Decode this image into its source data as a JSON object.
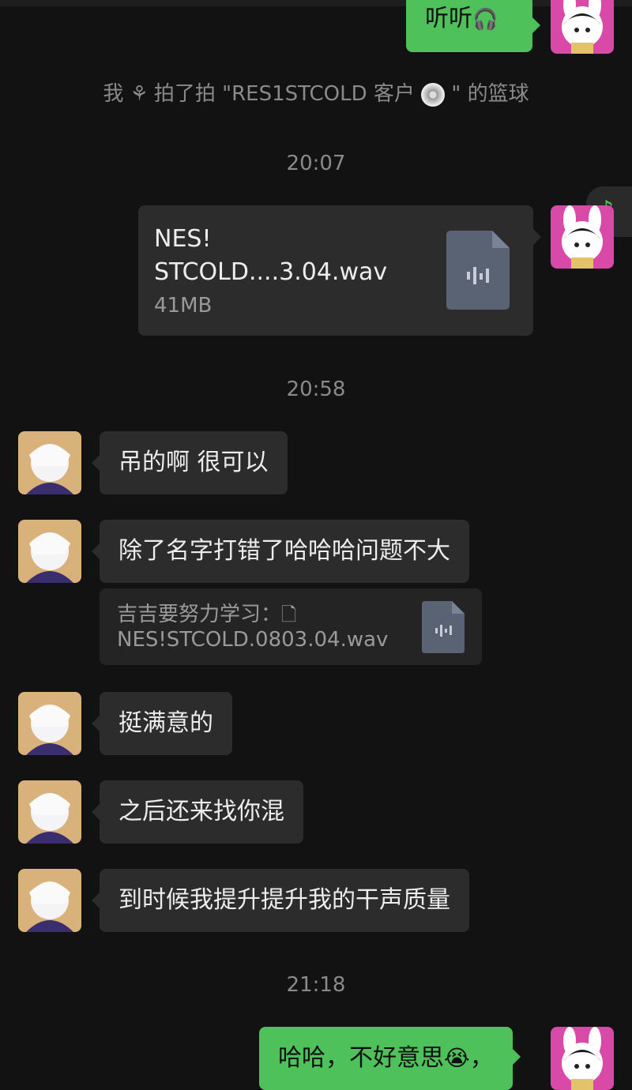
{
  "messages": {
    "m1": "听听",
    "m1_emoji": "🎧",
    "system_pat_prefix": "我",
    "system_pat_mid": "拍了拍 \"RES1STCOLD 客户",
    "system_pat_suffix": "\" 的篮球",
    "t1": "20:07",
    "file": {
      "name_line1": "NES!",
      "name_line2": "STCOLD....3.04.wav",
      "size": "41MB"
    },
    "t2": "20:58",
    "m2": "吊的啊 很可以",
    "m3": "除了名字打错了哈哈哈问题不大",
    "quote": {
      "line1": "吉吉要努力学习：",
      "line2": "NES!STCOLD.0803.04.wav"
    },
    "m4": "挺满意的",
    "m5": "之后还来找你混",
    "m6": "到时候我提升提升我的干声质量",
    "t3": "21:18",
    "m7": "哈哈，不好意思",
    "m7_emoji": "😭",
    "m7_trail": "，"
  },
  "colors": {
    "bg": "#121212",
    "incoming": "#2c2c2c",
    "outgoing": "#4fc15a",
    "meta": "#8a8a8a"
  }
}
